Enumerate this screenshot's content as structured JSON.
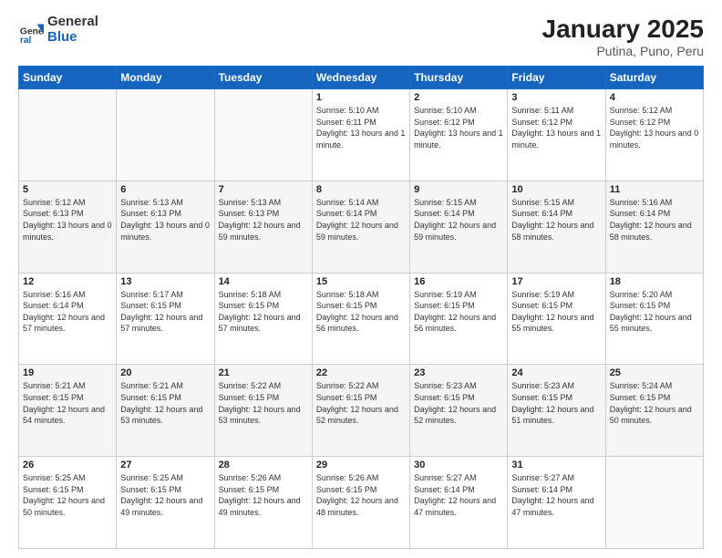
{
  "header": {
    "logo_general": "General",
    "logo_blue": "Blue",
    "title": "January 2025",
    "subtitle": "Putina, Puno, Peru"
  },
  "weekdays": [
    "Sunday",
    "Monday",
    "Tuesday",
    "Wednesday",
    "Thursday",
    "Friday",
    "Saturday"
  ],
  "weeks": [
    [
      {
        "day": "",
        "info": ""
      },
      {
        "day": "",
        "info": ""
      },
      {
        "day": "",
        "info": ""
      },
      {
        "day": "1",
        "info": "Sunrise: 5:10 AM\nSunset: 6:11 PM\nDaylight: 13 hours and 1 minute."
      },
      {
        "day": "2",
        "info": "Sunrise: 5:10 AM\nSunset: 6:12 PM\nDaylight: 13 hours and 1 minute."
      },
      {
        "day": "3",
        "info": "Sunrise: 5:11 AM\nSunset: 6:12 PM\nDaylight: 13 hours and 1 minute."
      },
      {
        "day": "4",
        "info": "Sunrise: 5:12 AM\nSunset: 6:12 PM\nDaylight: 13 hours and 0 minutes."
      }
    ],
    [
      {
        "day": "5",
        "info": "Sunrise: 5:12 AM\nSunset: 6:13 PM\nDaylight: 13 hours and 0 minutes."
      },
      {
        "day": "6",
        "info": "Sunrise: 5:13 AM\nSunset: 6:13 PM\nDaylight: 13 hours and 0 minutes."
      },
      {
        "day": "7",
        "info": "Sunrise: 5:13 AM\nSunset: 6:13 PM\nDaylight: 12 hours and 59 minutes."
      },
      {
        "day": "8",
        "info": "Sunrise: 5:14 AM\nSunset: 6:14 PM\nDaylight: 12 hours and 59 minutes."
      },
      {
        "day": "9",
        "info": "Sunrise: 5:15 AM\nSunset: 6:14 PM\nDaylight: 12 hours and 59 minutes."
      },
      {
        "day": "10",
        "info": "Sunrise: 5:15 AM\nSunset: 6:14 PM\nDaylight: 12 hours and 58 minutes."
      },
      {
        "day": "11",
        "info": "Sunrise: 5:16 AM\nSunset: 6:14 PM\nDaylight: 12 hours and 58 minutes."
      }
    ],
    [
      {
        "day": "12",
        "info": "Sunrise: 5:16 AM\nSunset: 6:14 PM\nDaylight: 12 hours and 57 minutes."
      },
      {
        "day": "13",
        "info": "Sunrise: 5:17 AM\nSunset: 6:15 PM\nDaylight: 12 hours and 57 minutes."
      },
      {
        "day": "14",
        "info": "Sunrise: 5:18 AM\nSunset: 6:15 PM\nDaylight: 12 hours and 57 minutes."
      },
      {
        "day": "15",
        "info": "Sunrise: 5:18 AM\nSunset: 6:15 PM\nDaylight: 12 hours and 56 minutes."
      },
      {
        "day": "16",
        "info": "Sunrise: 5:19 AM\nSunset: 6:15 PM\nDaylight: 12 hours and 56 minutes."
      },
      {
        "day": "17",
        "info": "Sunrise: 5:19 AM\nSunset: 6:15 PM\nDaylight: 12 hours and 55 minutes."
      },
      {
        "day": "18",
        "info": "Sunrise: 5:20 AM\nSunset: 6:15 PM\nDaylight: 12 hours and 55 minutes."
      }
    ],
    [
      {
        "day": "19",
        "info": "Sunrise: 5:21 AM\nSunset: 6:15 PM\nDaylight: 12 hours and 54 minutes."
      },
      {
        "day": "20",
        "info": "Sunrise: 5:21 AM\nSunset: 6:15 PM\nDaylight: 12 hours and 53 minutes."
      },
      {
        "day": "21",
        "info": "Sunrise: 5:22 AM\nSunset: 6:15 PM\nDaylight: 12 hours and 53 minutes."
      },
      {
        "day": "22",
        "info": "Sunrise: 5:22 AM\nSunset: 6:15 PM\nDaylight: 12 hours and 52 minutes."
      },
      {
        "day": "23",
        "info": "Sunrise: 5:23 AM\nSunset: 6:15 PM\nDaylight: 12 hours and 52 minutes."
      },
      {
        "day": "24",
        "info": "Sunrise: 5:23 AM\nSunset: 6:15 PM\nDaylight: 12 hours and 51 minutes."
      },
      {
        "day": "25",
        "info": "Sunrise: 5:24 AM\nSunset: 6:15 PM\nDaylight: 12 hours and 50 minutes."
      }
    ],
    [
      {
        "day": "26",
        "info": "Sunrise: 5:25 AM\nSunset: 6:15 PM\nDaylight: 12 hours and 50 minutes."
      },
      {
        "day": "27",
        "info": "Sunrise: 5:25 AM\nSunset: 6:15 PM\nDaylight: 12 hours and 49 minutes."
      },
      {
        "day": "28",
        "info": "Sunrise: 5:26 AM\nSunset: 6:15 PM\nDaylight: 12 hours and 49 minutes."
      },
      {
        "day": "29",
        "info": "Sunrise: 5:26 AM\nSunset: 6:15 PM\nDaylight: 12 hours and 48 minutes."
      },
      {
        "day": "30",
        "info": "Sunrise: 5:27 AM\nSunset: 6:14 PM\nDaylight: 12 hours and 47 minutes."
      },
      {
        "day": "31",
        "info": "Sunrise: 5:27 AM\nSunset: 6:14 PM\nDaylight: 12 hours and 47 minutes."
      },
      {
        "day": "",
        "info": ""
      }
    ]
  ]
}
